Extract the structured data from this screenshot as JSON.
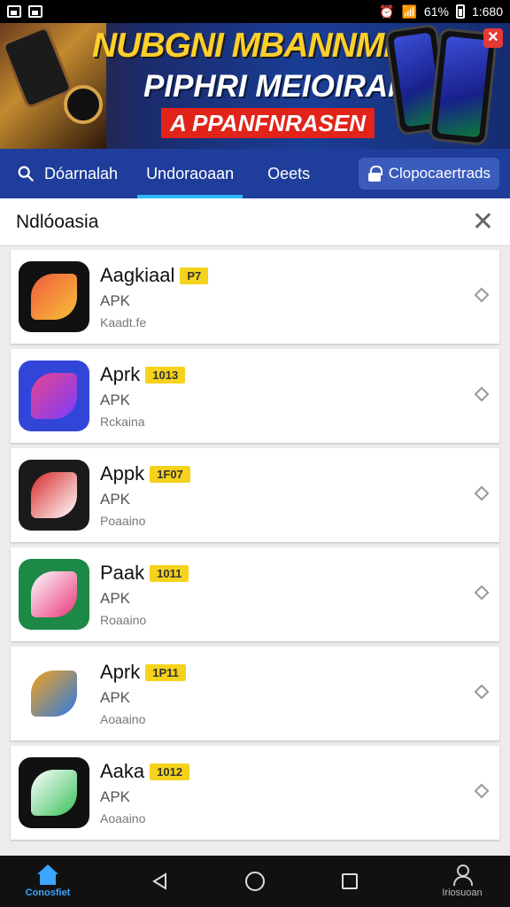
{
  "status_bar": {
    "battery": "61%",
    "time": "1:680"
  },
  "banner": {
    "title": "NUBGNI MBANNMEIAI",
    "subtitle": "PIPHRI MEIOIRAN",
    "tag": "A PPANFNRASEN",
    "close_label": "✕"
  },
  "tabs": {
    "search_label": "Dóarnalah",
    "active_tab": "Undoraoaan",
    "tab3": "Oeets",
    "pill_label": "Clopocaertrads"
  },
  "filter": {
    "label": "Ndlóoasia",
    "close": "✕"
  },
  "apps": [
    {
      "name": "Aagkiaal",
      "badge": "P7",
      "type": "APK",
      "sub": "Kaadt.fe",
      "colors": [
        "#111111",
        "#f05a3c",
        "#f8c13a"
      ]
    },
    {
      "name": "Aprk",
      "badge": "1013",
      "type": "APK",
      "sub": "Rckaina",
      "colors": [
        "#3146d8",
        "#e8458b",
        "#7b3cff"
      ]
    },
    {
      "name": "Apрk",
      "badge": "1F07",
      "type": "APK",
      "sub": "Poaaino",
      "colors": [
        "#1a1a1a",
        "#d62b2b",
        "#ffffff"
      ]
    },
    {
      "name": "Paak",
      "badge": "1011",
      "type": "APK",
      "sub": "Roaaino",
      "colors": [
        "#1c8a46",
        "#ffffff",
        "#e8347a"
      ]
    },
    {
      "name": "Aprk",
      "badge": "1P11",
      "type": "APK",
      "sub": "Aoaaino",
      "colors": [
        "#ffffff",
        "#f3a21b",
        "#2d7be6"
      ]
    },
    {
      "name": "Aaka",
      "badge": "1012",
      "type": "APK",
      "sub": "Aoaaino",
      "colors": [
        "#111111",
        "#ffffff",
        "#39c15a"
      ]
    }
  ],
  "bottom_nav": {
    "home_label": "Conosfiet",
    "profile_label": "Iriosuoan"
  }
}
